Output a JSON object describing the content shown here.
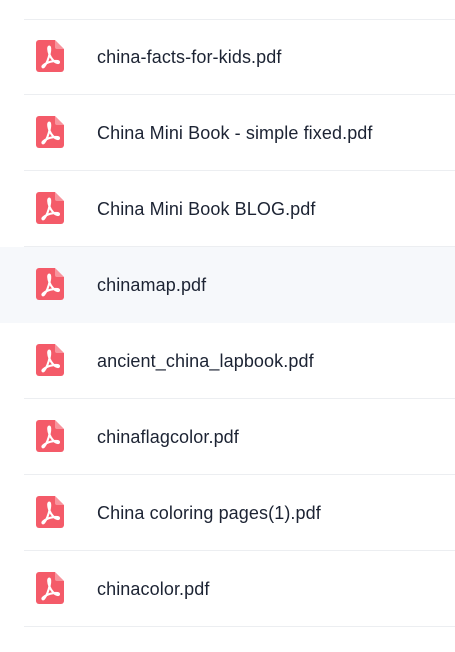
{
  "files": [
    {
      "name": "china-facts-for-kids.pdf",
      "icon": "pdf-file-icon"
    },
    {
      "name": "China Mini Book - simple fixed.pdf",
      "icon": "pdf-file-icon"
    },
    {
      "name": "China Mini Book BLOG.pdf",
      "icon": "pdf-file-icon"
    },
    {
      "name": "chinamap.pdf",
      "icon": "pdf-file-icon",
      "hovered": true
    },
    {
      "name": "ancient_china_lapbook.pdf",
      "icon": "pdf-file-icon"
    },
    {
      "name": "chinaflagcolor.pdf",
      "icon": "pdf-file-icon"
    },
    {
      "name": "China coloring pages(1).pdf",
      "icon": "pdf-file-icon"
    },
    {
      "name": "chinacolor.pdf",
      "icon": "pdf-file-icon"
    }
  ],
  "colors": {
    "pdf_icon": "#f45b69",
    "text": "#1c2333",
    "hover_bg": "#f6f8fb",
    "divider": "#eceef1"
  }
}
